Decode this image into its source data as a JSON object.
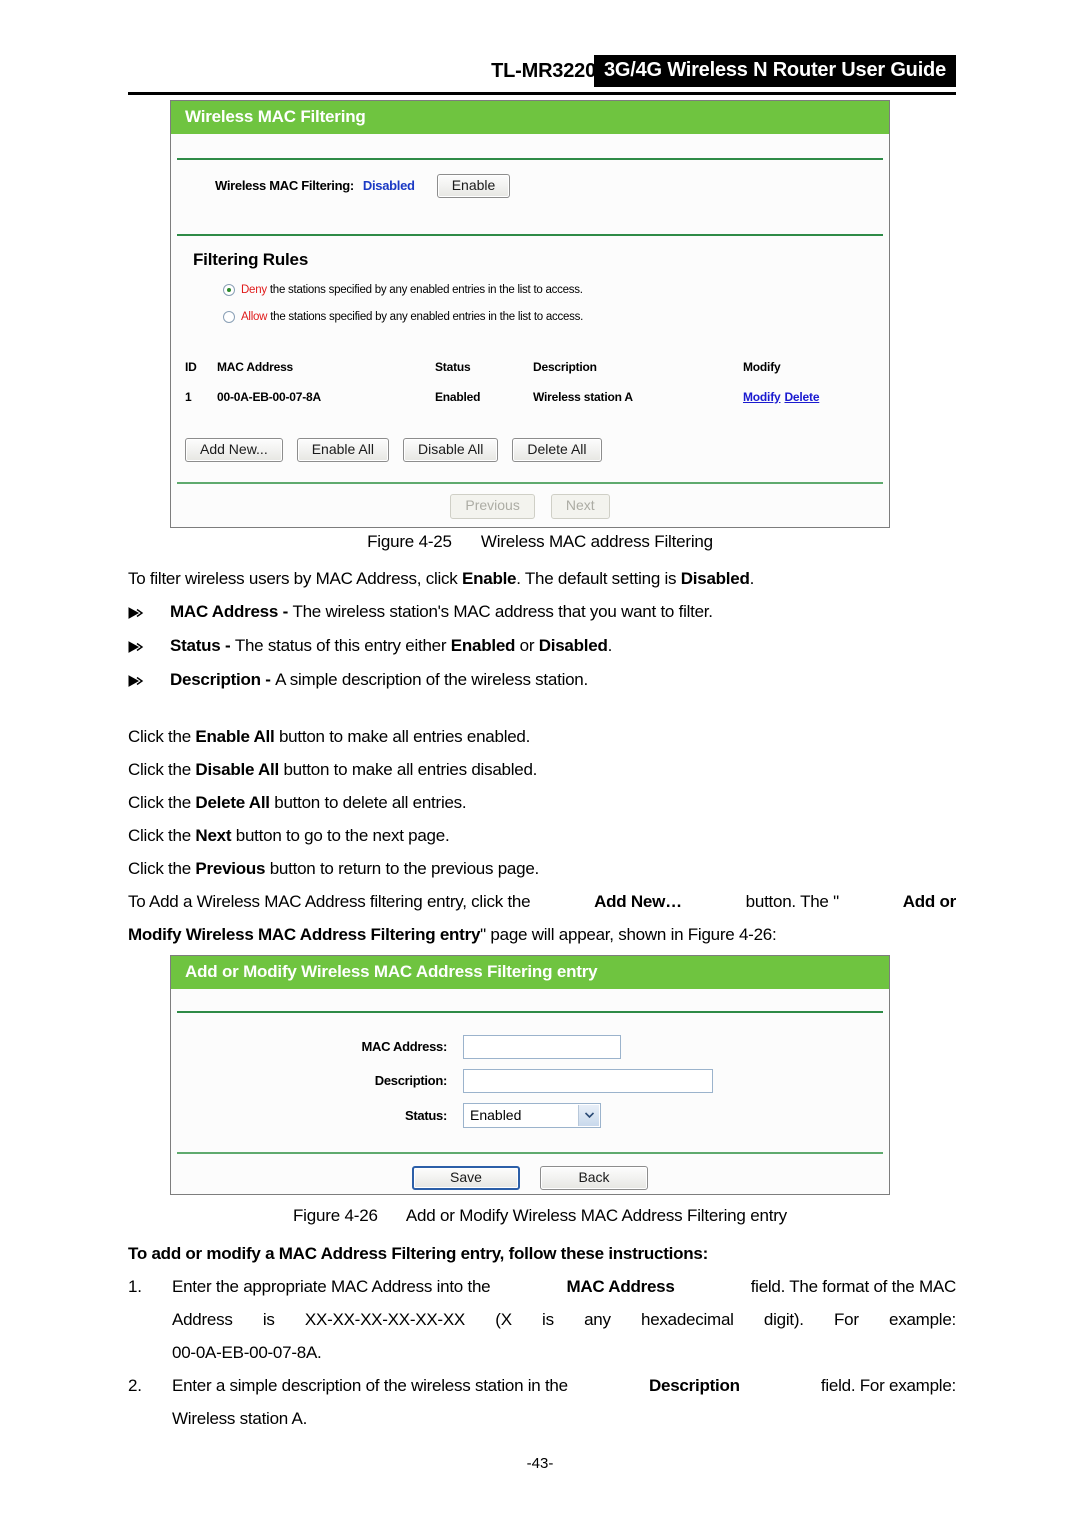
{
  "header": {
    "model": "TL-MR3220",
    "guide_title": "3G/4G Wireless N Router User Guide"
  },
  "figure1": {
    "panel_title": "Wireless MAC Filtering",
    "status_label": "Wireless MAC Filtering:",
    "status_value": "Disabled",
    "enable_button": "Enable",
    "rules_heading": "Filtering Rules",
    "rules": [
      {
        "keyword": "Deny",
        "rest": "the stations specified by any enabled entries in the list to access.",
        "selected": true
      },
      {
        "keyword": "Allow",
        "rest": "the stations specified by any enabled entries in the list to access.",
        "selected": false
      }
    ],
    "table": {
      "columns": [
        "ID",
        "MAC Address",
        "Status",
        "Description",
        "Modify"
      ],
      "rows": [
        {
          "id": "1",
          "mac": "00-0A-EB-00-07-8A",
          "status": "Enabled",
          "description": "Wireless station A",
          "modify_link": "Modify",
          "delete_link": "Delete"
        }
      ]
    },
    "buttons": [
      "Add New...",
      "Enable All",
      "Disable All",
      "Delete All"
    ],
    "pager": [
      "Previous",
      "Next"
    ],
    "caption_number": "Figure 4-25",
    "caption_text": "Wireless MAC address Filtering"
  },
  "figure2": {
    "panel_title": "Add or Modify Wireless MAC Address Filtering entry",
    "fields": [
      {
        "label": "MAC Address:",
        "value": "",
        "type": "text"
      },
      {
        "label": "Description:",
        "value": "",
        "type": "text"
      },
      {
        "label": "Status:",
        "value": "Enabled",
        "type": "select"
      }
    ],
    "buttons": [
      "Save",
      "Back"
    ],
    "caption_number": "Figure 4-26",
    "caption_text": "Add or Modify Wireless MAC Address Filtering entry"
  },
  "body": {
    "intro": {
      "p1": "To filter wireless users by MAC Address, click ",
      "p1_b1": "Enable",
      "p2": ". The default setting is ",
      "p2_b2": "Disabled",
      "p3": "."
    },
    "bullets": [
      {
        "term": "MAC Address",
        "dash": " - ",
        "text": "The wireless station's MAC address that you want to filter."
      },
      {
        "term": "Status",
        "dash": " - ",
        "text_a": "The status of this entry either ",
        "bold_a": "Enabled",
        "text_b": " or ",
        "bold_b": "Disabled",
        "text_c": "."
      },
      {
        "term": "Description",
        "dash": " - ",
        "text": "A simple description of the wireless station."
      }
    ],
    "clicks": [
      {
        "pre": "Click the ",
        "bold": "Enable All",
        "post": " button to make all entries enabled."
      },
      {
        "pre": "Click the ",
        "bold": "Disable All",
        "post": " button to make all entries disabled."
      },
      {
        "pre": "Click the ",
        "bold": "Delete All",
        "post": " button to delete all entries."
      },
      {
        "pre": "Click the ",
        "bold": "Next",
        "post": " button to go to the next page."
      },
      {
        "pre": "Click the ",
        "bold": "Previous",
        "post": " button to return to the previous page."
      }
    ],
    "addnew_para": {
      "l1_a": "To Add a Wireless MAC Address filtering entry, click the",
      "l1_b": "Add New…",
      "l1_c": "button. The \"",
      "l1_d": "Add or",
      "l2_a": "Modify Wireless MAC Address Filtering entry",
      "l2_b": "\" page will appear, shown in Figure 4-26:"
    },
    "instructions_heading": "To add or modify a MAC Address Filtering entry, follow these instructions:",
    "instructions": [
      {
        "marker": "1.",
        "l1_a": "Enter the appropriate MAC Address into the",
        "l1_b": "MAC Address",
        "l1_c": "field. The format of the MAC",
        "l2": "Address is XX-XX-XX-XX-XX-XX (X is any hexadecimal digit). For example:",
        "l3": "00-0A-EB-00-07-8A."
      },
      {
        "marker": "2.",
        "l1_a": "Enter a simple description of the wireless station in the",
        "l1_b": "Description",
        "l1_c": "field. For example:",
        "l2": "Wireless station A."
      }
    ]
  },
  "footer": {
    "page_number": "-43-"
  },
  "colors": {
    "panel_green": "#6fc440",
    "rule_green": "#2e8b47",
    "link_blue": "#1a1ad0",
    "status_blue": "#1a39c4",
    "keyword_red": "#e01b1b",
    "radio_dot_green": "#2a8a2a"
  }
}
